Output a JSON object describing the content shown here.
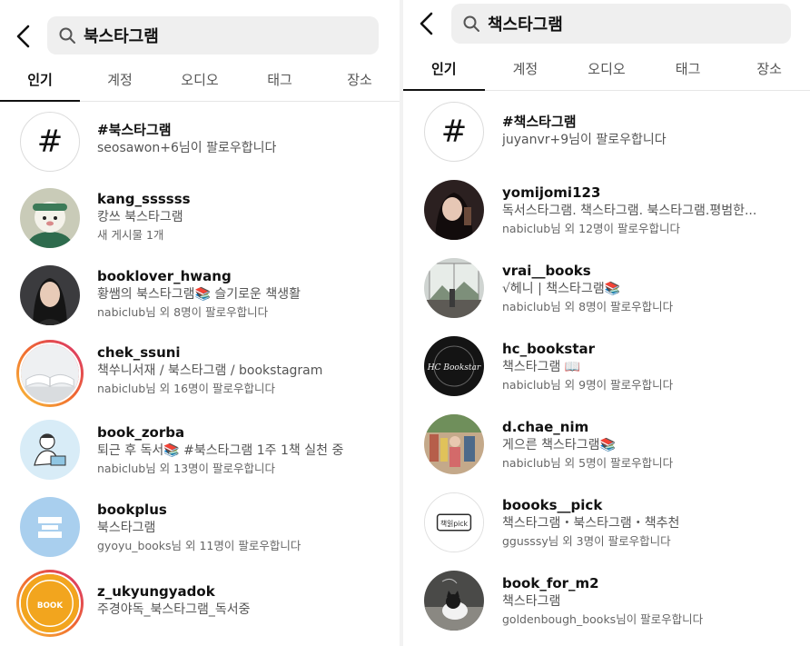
{
  "left": {
    "query": "북스타그램",
    "tabs": [
      "인기",
      "계정",
      "오디오",
      "태그",
      "장소"
    ],
    "results": [
      {
        "name": "#북스타그램",
        "sub": "seosawon+6님이 팔로우합니다",
        "meta": "",
        "avatar": "hashtag-icon"
      },
      {
        "name": "kang_ssssss",
        "sub": "캉쓰 북스타그램",
        "meta": "새 게시물 1개",
        "avatar": "cartoon-avatar"
      },
      {
        "name": "booklover_hwang",
        "sub": "황쌤의 북스타그램📚 슬기로운 책생활",
        "meta": "nabiclub님 외 8명이 팔로우합니다",
        "avatar": "portrait-avatar"
      },
      {
        "name": "chek_ssuni",
        "sub": "책쑤니서재 / 북스타그램 / bookstagram",
        "meta": "nabiclub님 외 16명이 팔로우합니다",
        "avatar": "open-book-avatar"
      },
      {
        "name": "book_zorba",
        "sub": "퇴근 후 독서📚  #북스타그램  1주 1책 실천 중",
        "meta": "nabiclub님 외 13명이 팔로우합니다",
        "avatar": "reader-illustration-avatar"
      },
      {
        "name": "bookplus",
        "sub": "북스타그램",
        "meta": "gyoyu_books님 외 11명이 팔로우합니다",
        "avatar": "bookplus-logo-avatar"
      },
      {
        "name": "z_ukyungyadok",
        "sub": "주경야독_북스타그램_독서중",
        "meta": "",
        "avatar": "book-archive-logo-avatar"
      }
    ]
  },
  "right": {
    "query": "책스타그램",
    "tabs": [
      "인기",
      "계정",
      "오디오",
      "태그",
      "장소"
    ],
    "results": [
      {
        "name": "#책스타그램",
        "sub": "juyanvr+9님이 팔로우합니다",
        "meta": "",
        "avatar": "hashtag-icon"
      },
      {
        "name": "yomijomi123",
        "sub": "독서스타그램. 책스타그램. 북스타그램.평범한...",
        "meta": "nabiclub님 외 12명이 팔로우합니다",
        "avatar": "portrait-avatar"
      },
      {
        "name": "vrai__books",
        "sub": "√헤니 | 책스타그램📚",
        "meta": "nabiclub님 외 8명이 팔로우합니다",
        "avatar": "window-view-avatar"
      },
      {
        "name": "hc_bookstar",
        "sub": "책스타그램 📖",
        "meta": "nabiclub님 외 9명이 팔로우합니다",
        "avatar": "hc-bookstar-logo-avatar"
      },
      {
        "name": "d.chae_nim",
        "sub": "게으른 책스타그램📚",
        "meta": "nabiclub님 외 5명이 팔로우합니다",
        "avatar": "bookshelf-photo-avatar"
      },
      {
        "name": "boooks__pick",
        "sub": "책스타그램・북스타그램・책추천",
        "meta": "ggusssy님 외 3명이 팔로우합니다",
        "avatar": "booxpick-logo-avatar"
      },
      {
        "name": "book_for_m2",
        "sub": "책스타그램",
        "meta": "goldenbough_books님이 팔로우합니다",
        "avatar": "cat-photo-avatar"
      }
    ]
  },
  "icons": {
    "back": "chevron-left-icon",
    "search": "search-icon"
  },
  "logo_text": {
    "hc": "HC Bookstar",
    "booxpick": "책읽pick",
    "archive": "주경야독 BOOK ARCHIVE"
  }
}
